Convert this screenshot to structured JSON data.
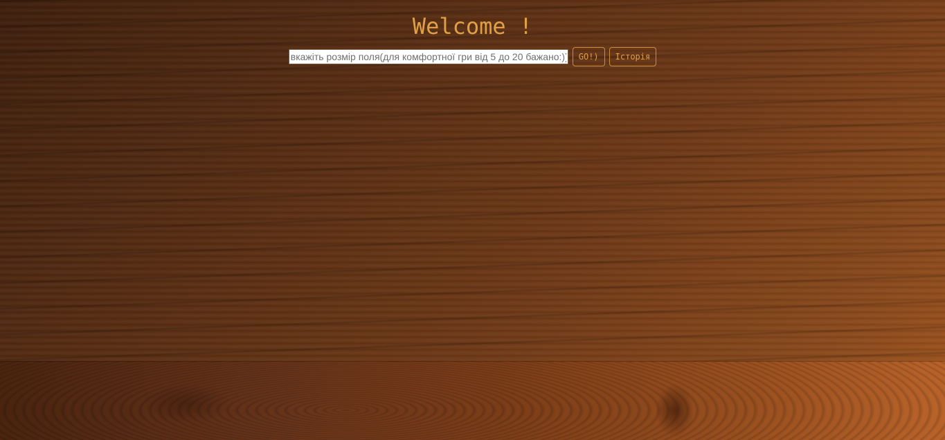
{
  "header": {
    "title": "Welcome !"
  },
  "form": {
    "size_input": {
      "value": "",
      "placeholder": "вкажіть розмір поля(для комфортної гри від 5 до 20 бажано:))"
    },
    "go_label": "GO!)",
    "history_label": "Історія"
  },
  "colors": {
    "accent": "#e0a047",
    "wood_dark": "#3f200e",
    "wood_light": "#b9632a"
  }
}
